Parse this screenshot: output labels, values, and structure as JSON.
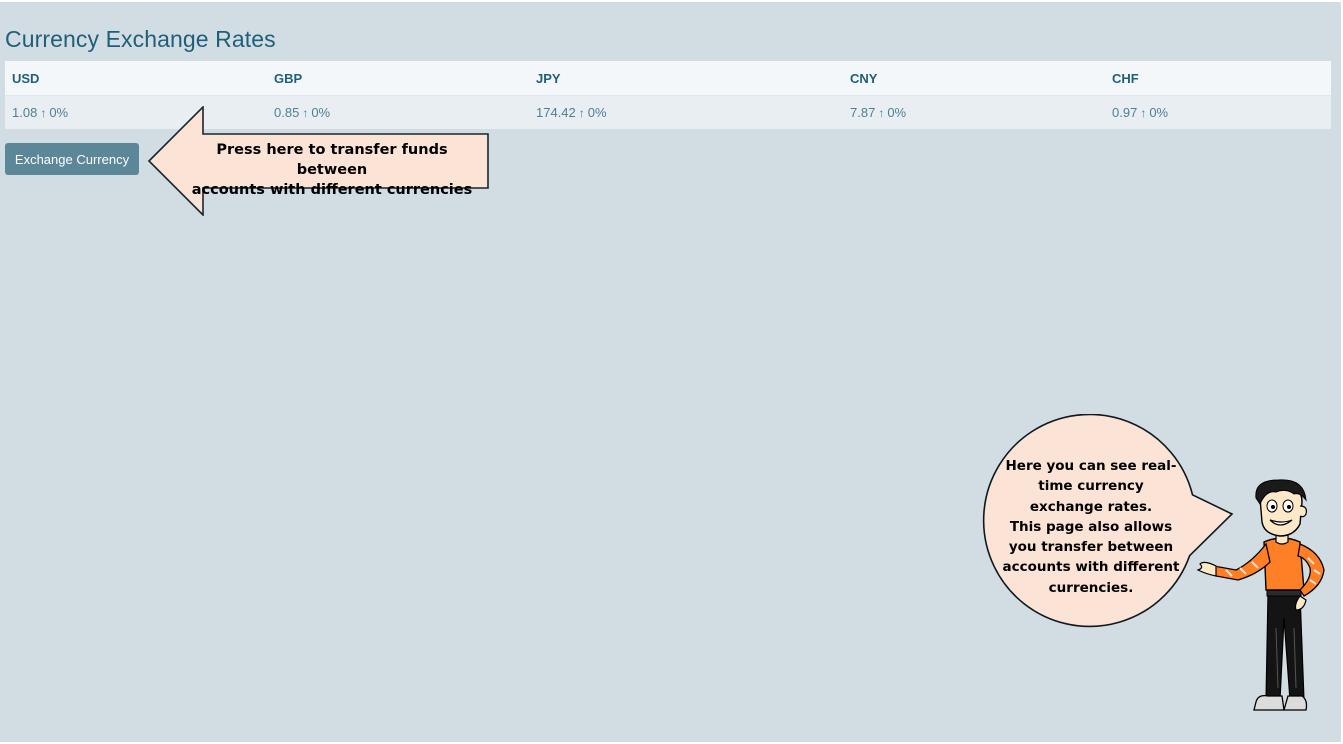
{
  "page": {
    "title": "Currency Exchange Rates"
  },
  "rates": {
    "headers": [
      "USD",
      "GBP",
      "JPY",
      "CNY",
      "CHF"
    ],
    "values": [
      {
        "rate": "1.08",
        "trend": "↑",
        "change": "0%"
      },
      {
        "rate": "0.85",
        "trend": "↑",
        "change": "0%"
      },
      {
        "rate": "174.42",
        "trend": "↑",
        "change": "0%"
      },
      {
        "rate": "7.87",
        "trend": "↑",
        "change": "0%"
      },
      {
        "rate": "0.97",
        "trend": "↑",
        "change": "0%"
      }
    ]
  },
  "actions": {
    "exchange_label": "Exchange Currency"
  },
  "tutorial": {
    "arrow_text_line1": "Press here to transfer funds between",
    "arrow_text_line2": "accounts with different currencies",
    "bubble_lines": [
      "Here you can see real-",
      "time currency",
      "exchange rates.",
      "This page also allows",
      "you transfer between",
      "accounts with different",
      "currencies."
    ]
  },
  "colors": {
    "background": "#d2dde3",
    "title": "#1f5f79",
    "button": "#5b8799",
    "callout_fill": "#fbe3d6",
    "shirt": "#ff7f27"
  }
}
